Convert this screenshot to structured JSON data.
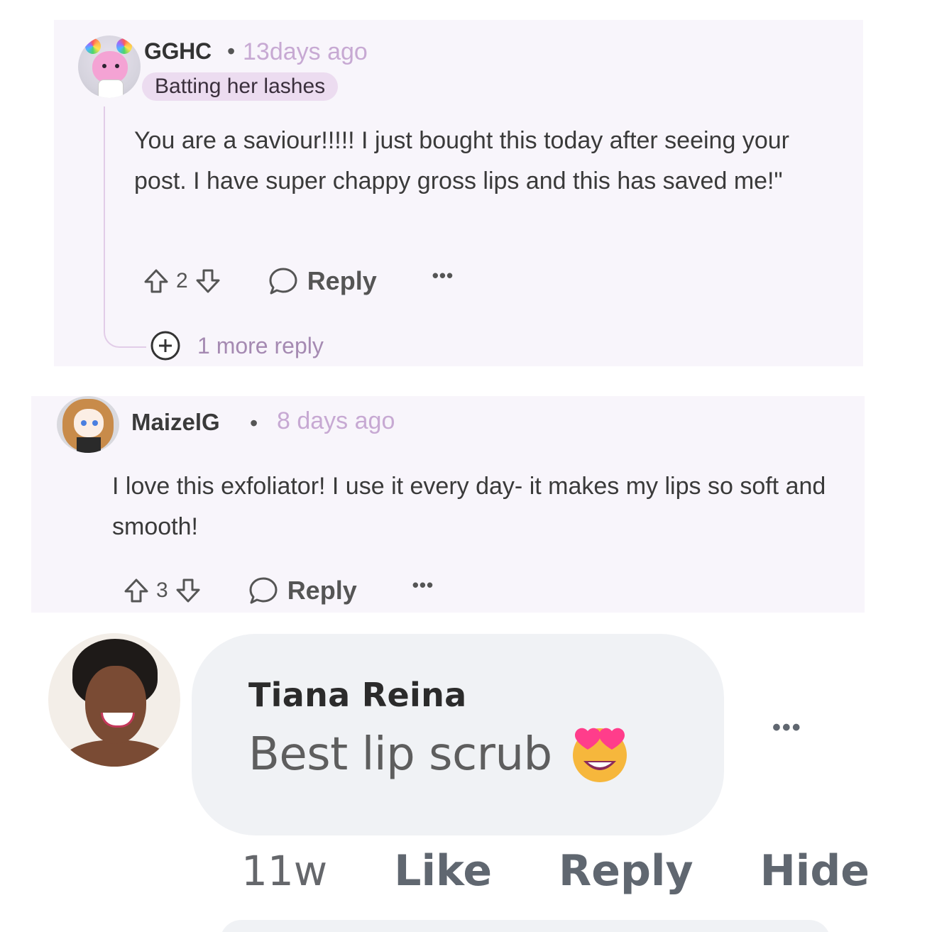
{
  "comments": [
    {
      "username": "GGHC",
      "separator": "•",
      "time": "13days ago",
      "flair": "Batting her lashes",
      "body": "You are a saviour!!!!! I just bought this today after seeing your post. I have super chappy gross lips and this has saved me!\"",
      "votes": "2",
      "reply_label": "Reply",
      "more_label": "•••",
      "more_replies": "1 more reply"
    },
    {
      "username": "MaizelG",
      "separator": "•",
      "time": "8 days ago",
      "body": "I love this exfoliator! I use it every day- it makes my lips so soft and smooth!",
      "votes": "3",
      "reply_label": "Reply",
      "more_label": "•••"
    }
  ],
  "fb_comment": {
    "author": "Tiana Reina",
    "text": "Best lip scrub",
    "emoji": "heart-eyes-emoji",
    "more_label": "•••",
    "time": "11w",
    "like_label": "Like",
    "reply_label": "Reply",
    "hide_label": "Hide"
  },
  "colors": {
    "card_bg": "#f8f5fb",
    "timestamp": "#c7a9d3",
    "flair_bg": "#ecdcf0",
    "bubble_bg": "#f0f2f5",
    "more_replies": "#a58ab2"
  },
  "icons": [
    "upvote-icon",
    "downvote-icon",
    "comment-icon",
    "expand-icon",
    "heart-eyes-emoji"
  ]
}
